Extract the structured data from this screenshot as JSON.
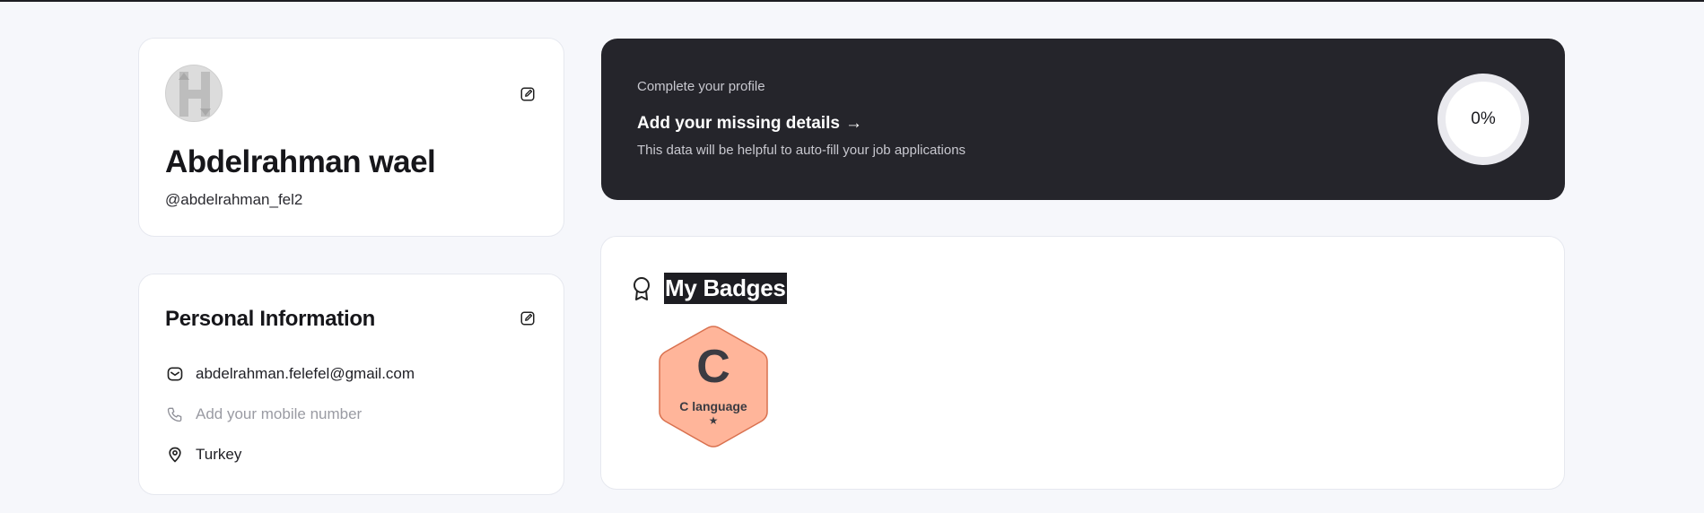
{
  "profile": {
    "name": "Abdelrahman wael",
    "handle": "@abdelrahman_fel2",
    "edit_icon": "edit-icon",
    "avatar_icon": "avatar-h-logo"
  },
  "personal_info": {
    "title": "Personal Information",
    "email": "abdelrahman.felefel@gmail.com",
    "phone_placeholder": "Add your mobile number",
    "location": "Turkey",
    "icons": {
      "email": "mail-icon",
      "phone": "phone-icon",
      "location": "location-pin-icon"
    }
  },
  "completion": {
    "eyebrow": "Complete your profile",
    "link_label": "Add your missing details",
    "link_arrow": "→",
    "description": "This data will be helpful to auto-fill your job applications",
    "progress_label": "0%",
    "progress_fraction": 0
  },
  "badges": {
    "title": "My Badges",
    "items": [
      {
        "letter": "C",
        "label": "C language",
        "stars": "★",
        "color": "#ffb59a",
        "border": "#d9714f"
      }
    ]
  },
  "colors": {
    "background": "#f6f7fb",
    "dark_card": "#25252b",
    "badge_fill": "#ffb59a"
  }
}
